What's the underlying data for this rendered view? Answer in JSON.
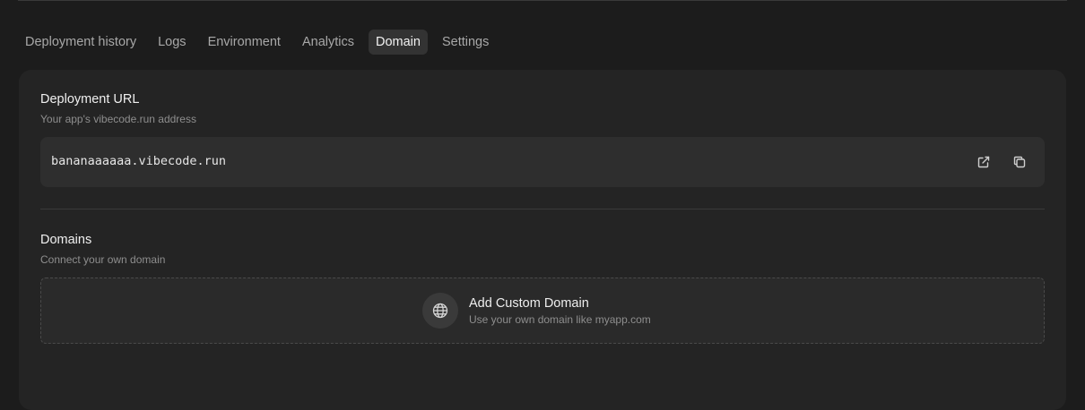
{
  "tabs": [
    {
      "label": "Deployment history",
      "active": false
    },
    {
      "label": "Logs",
      "active": false
    },
    {
      "label": "Environment",
      "active": false
    },
    {
      "label": "Analytics",
      "active": false
    },
    {
      "label": "Domain",
      "active": true
    },
    {
      "label": "Settings",
      "active": false
    }
  ],
  "deployment": {
    "title": "Deployment URL",
    "subtitle": "Your app's vibecode.run address",
    "url": "bananaaaaaa.vibecode.run",
    "open_icon": "external-link-icon",
    "copy_icon": "copy-icon"
  },
  "domains": {
    "title": "Domains",
    "subtitle": "Connect your own domain",
    "add_title": "Add Custom Domain",
    "add_subtitle": "Use your own domain like myapp.com",
    "add_icon": "globe-icon"
  },
  "colors": {
    "background": "#1c1c1c",
    "panel": "#242424",
    "active_tab": "#333333",
    "muted_text": "#8e8e8e"
  }
}
